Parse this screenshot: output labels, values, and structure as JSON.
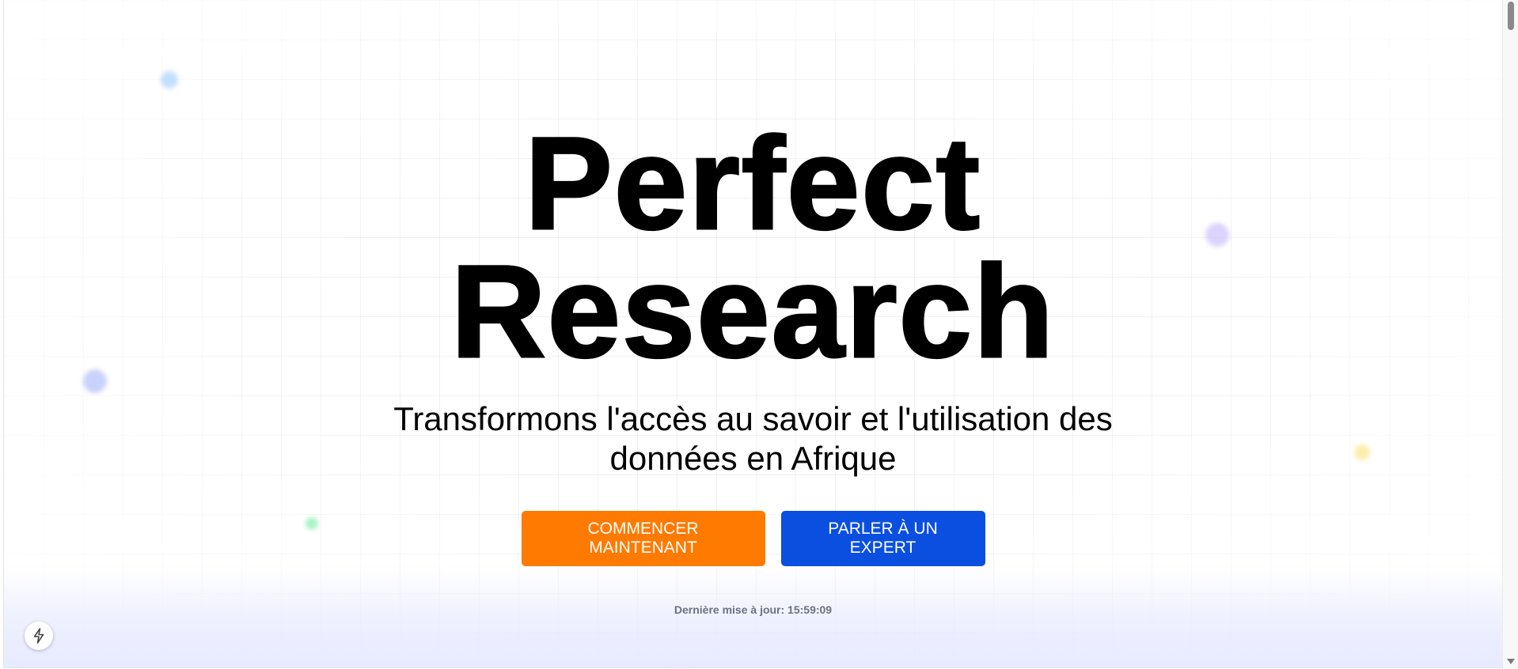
{
  "hero": {
    "title_line1": "Perfect",
    "title_line2": "Research",
    "subtitle_line1": "Transformons l'accès au savoir et l'utilisation des",
    "subtitle_line2": "données en Afrique"
  },
  "actions": {
    "primary_label": "COMMENCER MAINTENANT",
    "secondary_label": "PARLER À UN EXPERT"
  },
  "footer": {
    "last_updated": "Dernière mise à jour: 15:59:09"
  },
  "icons": {
    "badge": "lightning-bolt-icon"
  },
  "colors": {
    "primary_button": "#ff7a00",
    "secondary_button": "#0a4fe0",
    "title": "#000000",
    "muted_text": "#6b7280"
  }
}
